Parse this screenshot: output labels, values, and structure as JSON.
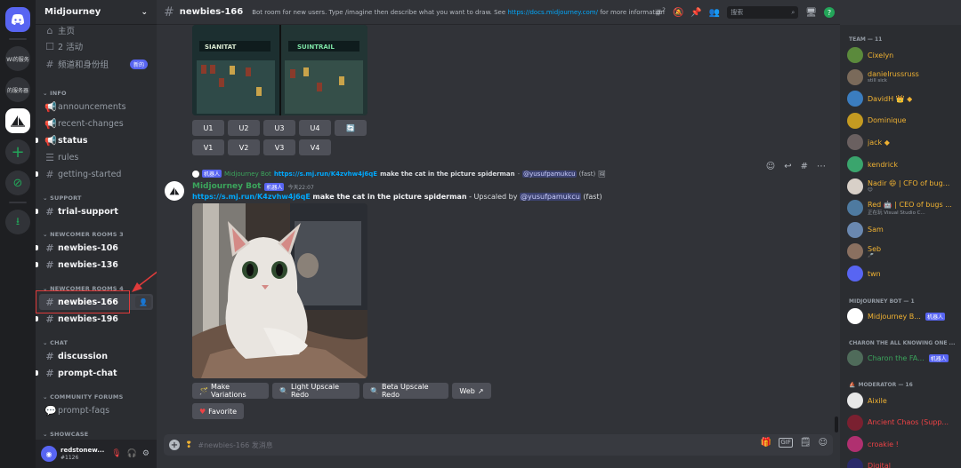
{
  "rail": {
    "servers": [
      {
        "label": "Wi的服务"
      },
      {
        "label": "的服务器"
      }
    ]
  },
  "sidebar": {
    "guild_name": "Midjourney",
    "top": [
      {
        "label": "主页"
      },
      {
        "label": "2 活动"
      },
      {
        "label": "频道和身份组",
        "badge": "新的"
      }
    ],
    "categories": {
      "info": "INFO",
      "support": "SUPPORT",
      "newcomer3": "NEWCOMER ROOMS 3",
      "newcomer4": "NEWCOMER ROOMS 4",
      "chat": "CHAT",
      "community": "COMMUNITY FORUMS",
      "showcase": "SHOWCASE"
    },
    "channels": {
      "announcements": "announcements",
      "recent_changes": "recent-changes",
      "status": "status",
      "rules": "rules",
      "getting_started": "getting-started",
      "trial_support": "trial-support",
      "newbies_106": "newbies-106",
      "newbies_136": "newbies-136",
      "newbies_166": "newbies-166",
      "newbies_196": "newbies-196",
      "discussion": "discussion",
      "prompt_chat": "prompt-chat",
      "prompt_faqs": "prompt-faqs"
    },
    "user": {
      "name": "redstonew...",
      "tag": "#1126"
    }
  },
  "header": {
    "channel": "newbies-166",
    "topic_pre": "Bot room for new users. Type /imagine then describe what you want to draw. See ",
    "topic_link": "https://docs.midjourney.com/",
    "topic_post": " for more information",
    "thread_count": "2",
    "search_placeholder": "搜索"
  },
  "messages": {
    "grid_buttons": [
      "U1",
      "U2",
      "U3",
      "U4",
      "V1",
      "V2",
      "V3",
      "V4"
    ],
    "reply": {
      "bot": "Midjourney Bot",
      "tag": "机器人",
      "link": "https://s.mj.run/K4zvhw4j6qE",
      "prompt": "make the cat in the picture spiderman",
      "mention": "@yusufpamukcu",
      "speed": "(fast)"
    },
    "message": {
      "author": "Midjourney Bot",
      "tag": "机器人",
      "time": "今天22:07",
      "link": "https://s.mj.run/K4zvhw4j6qE",
      "prompt": "make the cat in the picture spiderman",
      "upscaled": " - Upscaled by ",
      "mention": "@yusufpamukcu",
      "speed": "(fast)"
    },
    "actions": {
      "make_variations": "Make Variations",
      "light": "Light Upscale Redo",
      "beta": "Beta Upscale Redo",
      "web": "Web",
      "favorite": "Favorite"
    },
    "image_signs": [
      "SIANITAT",
      "SUINTRAIL"
    ]
  },
  "composer": {
    "placeholder": "#newbies-166 发消息"
  },
  "members": {
    "team_header": "TEAM — 11",
    "team": [
      {
        "name": "Cixelyn",
        "color": "#f0b232",
        "sub": ""
      },
      {
        "name": "danielrussruss",
        "color": "#f0b232",
        "sub": "still sick"
      },
      {
        "name": "DavidH 👑 ◆",
        "color": "#f0b232",
        "sub": ""
      },
      {
        "name": "Dominique",
        "color": "#f0b232",
        "sub": ""
      },
      {
        "name": "jack ◆",
        "color": "#f0b232",
        "sub": ""
      },
      {
        "name": "kendrick",
        "color": "#f0b232",
        "sub": ""
      },
      {
        "name": "Nadir 😄 | CFO of bug...",
        "color": "#f0b232",
        "sub": "😊"
      },
      {
        "name": "Red 🤖 | CEO of bugs ...",
        "color": "#f0b232",
        "sub": "正在玩 Visual Studio C..."
      },
      {
        "name": "Sam",
        "color": "#f0b232",
        "sub": ""
      },
      {
        "name": "Seb",
        "color": "#f0b232",
        "sub": "🎤"
      },
      {
        "name": "twn",
        "color": "#f0b232",
        "sub": ""
      }
    ],
    "bot_header": "MIDJOURNEY BOT — 1",
    "bot": {
      "name": "Midjourney B...",
      "tag": "机器人",
      "color": "#f0b232"
    },
    "charon_header": "CHARON THE ALL KNOWING ONE ...",
    "charon": {
      "name": "Charon the FA...",
      "tag": "机器人",
      "color": "#3ba55c"
    },
    "mod_header": "MODERATOR — 16",
    "mods": [
      {
        "name": "Aixile",
        "color": "#f0b232"
      },
      {
        "name": "Ancient Chaos (Supp...",
        "color": "#ed4245"
      },
      {
        "name": "croakie !",
        "color": "#ed4245"
      },
      {
        "name": "Digital",
        "color": "#ed4245"
      }
    ]
  }
}
